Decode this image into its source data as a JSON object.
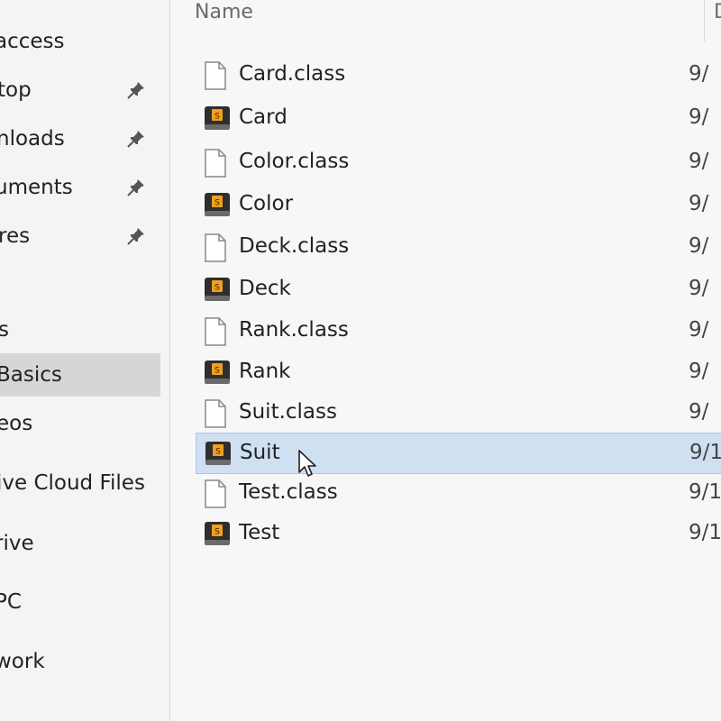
{
  "sidebar": {
    "items": [
      {
        "label": "access",
        "pinned": false,
        "selected": false
      },
      {
        "label": "top",
        "pinned": true,
        "selected": false
      },
      {
        "label": "nloads",
        "pinned": true,
        "selected": false
      },
      {
        "label": "uments",
        "pinned": true,
        "selected": false
      },
      {
        "label": "res",
        "pinned": true,
        "selected": false
      },
      {
        "label": "s",
        "pinned": false,
        "selected": false
      },
      {
        "label": "Basics",
        "pinned": false,
        "selected": true
      },
      {
        "label": "eos",
        "pinned": false,
        "selected": false
      },
      {
        "label": "ive Cloud Files",
        "pinned": false,
        "selected": false
      },
      {
        "label": "rive",
        "pinned": false,
        "selected": false
      },
      {
        "label": "PC",
        "pinned": false,
        "selected": false
      },
      {
        "label": "work",
        "pinned": false,
        "selected": false
      }
    ]
  },
  "columns": {
    "name": "Name",
    "date": "D"
  },
  "files": [
    {
      "name": "Card.class",
      "type": "class-file",
      "date": "9/"
    },
    {
      "name": "Card",
      "type": "sublime-file",
      "date": "9/"
    },
    {
      "name": "Color.class",
      "type": "class-file",
      "date": "9/"
    },
    {
      "name": "Color",
      "type": "sublime-file",
      "date": "9/"
    },
    {
      "name": "Deck.class",
      "type": "class-file",
      "date": "9/"
    },
    {
      "name": "Deck",
      "type": "sublime-file",
      "date": "9/"
    },
    {
      "name": "Rank.class",
      "type": "class-file",
      "date": "9/"
    },
    {
      "name": "Rank",
      "type": "sublime-file",
      "date": "9/"
    },
    {
      "name": "Suit.class",
      "type": "class-file",
      "date": "9/"
    },
    {
      "name": "Suit",
      "type": "sublime-file",
      "date": "9/1",
      "selected": true
    },
    {
      "name": "Test.class",
      "type": "class-file",
      "date": "9/1"
    },
    {
      "name": "Test",
      "type": "sublime-file",
      "date": "9/1"
    }
  ],
  "icons": {
    "class_file": "blank-document-icon",
    "sublime_file": "sublime-text-file-icon",
    "pin": "pin-icon",
    "cursor": "mouse-pointer-icon"
  },
  "colors": {
    "selection_bg": "#cfe0f2",
    "selection_border": "#a8c8ea",
    "sidebar_selected": "#d6d6d6",
    "sublime_orange": "#f0a020"
  }
}
